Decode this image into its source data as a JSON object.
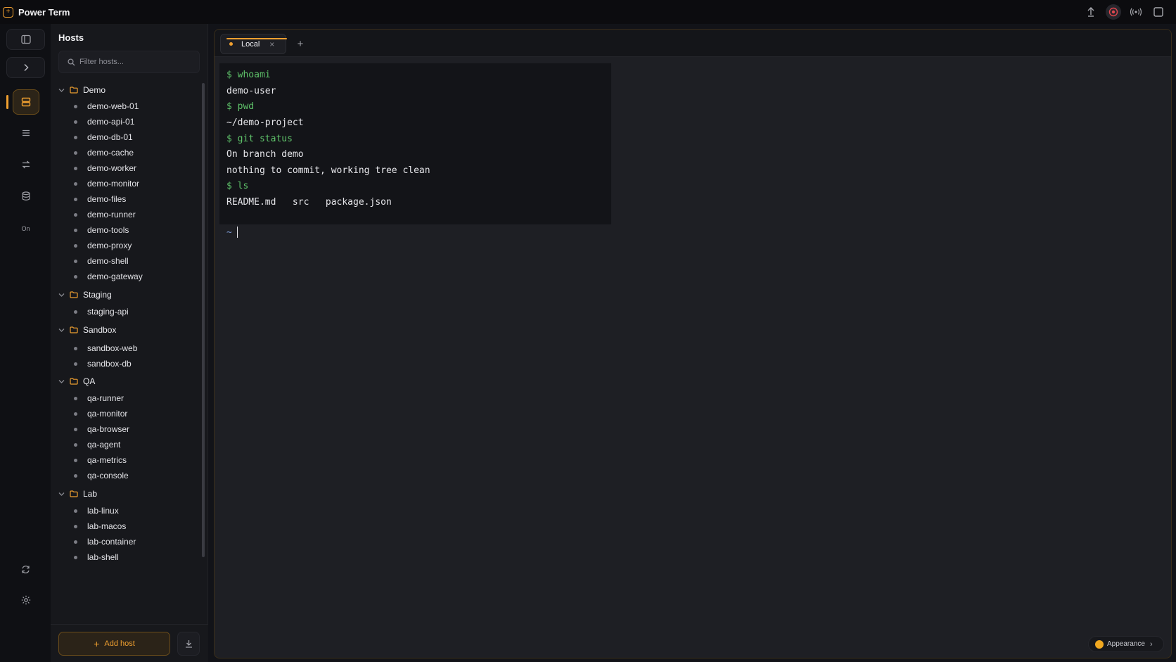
{
  "app": {
    "title": "Power Term",
    "logo_glyph": "+"
  },
  "window_actions": [
    {
      "name": "sync-up-icon"
    },
    {
      "name": "record-icon",
      "active": true
    },
    {
      "name": "broadcast-icon"
    },
    {
      "name": "maximize-icon"
    }
  ],
  "rail": {
    "misc_label": "On"
  },
  "sidebar": {
    "title": "Hosts",
    "search_placeholder": "Filter hosts...",
    "groups": [
      {
        "name": "Demo",
        "hosts": [
          "demo-web-01",
          "demo-api-01",
          "demo-db-01",
          "demo-cache",
          "demo-worker",
          "demo-monitor",
          "demo-files",
          "demo-runner",
          "demo-tools",
          "demo-proxy",
          "demo-shell",
          "demo-gateway"
        ]
      },
      {
        "name": "Staging",
        "hosts": [
          "staging-api"
        ]
      },
      {
        "name": "Sandbox",
        "hosts": [
          "sandbox-web",
          "sandbox-db"
        ]
      },
      {
        "name": "QA",
        "hosts": [
          "qa-runner",
          "qa-monitor",
          "qa-browser",
          "qa-agent",
          "qa-metrics",
          "qa-console"
        ]
      },
      {
        "name": "Lab",
        "hosts": [
          "lab-linux",
          "lab-macos",
          "lab-container",
          "lab-shell"
        ]
      }
    ],
    "add_host_label": "Add host"
  },
  "tabs": [
    {
      "label": "Local",
      "active": true
    }
  ],
  "terminal": {
    "lines": [
      {
        "type": "cmd",
        "text": "$ whoami"
      },
      {
        "type": "out",
        "text": "demo-user"
      },
      {
        "type": "cmd",
        "text": "$ pwd"
      },
      {
        "type": "out",
        "text": "~/demo-project"
      },
      {
        "type": "cmd",
        "text": "$ git status"
      },
      {
        "type": "out",
        "text": "On branch demo"
      },
      {
        "type": "out",
        "text": "nothing to commit, working tree clean"
      },
      {
        "type": "cmd",
        "text": "$ ls"
      },
      {
        "type": "out",
        "text": "README.md   src   package.json"
      }
    ],
    "prompt": "~"
  },
  "appearance": {
    "label": "Appearance"
  },
  "colors": {
    "accent": "#f0a030",
    "command": "#5fc36a",
    "prompt": "#7f9cd6"
  }
}
